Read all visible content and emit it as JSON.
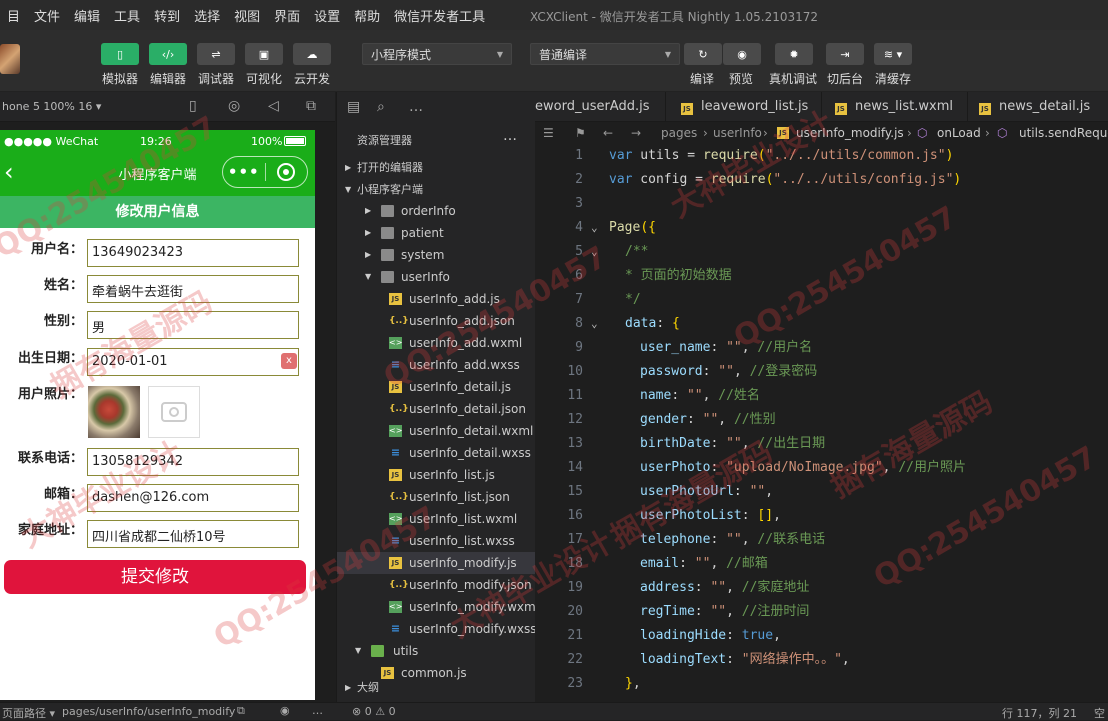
{
  "menubar": {
    "items": [
      "目",
      "文件",
      "编辑",
      "工具",
      "转到",
      "选择",
      "视图",
      "界面",
      "设置",
      "帮助",
      "微信开发者工具"
    ],
    "window_title": "XCXClient - 微信开发者工具 Nightly 1.05.2103172"
  },
  "toolbar": {
    "buttons": [
      {
        "label": "模拟器",
        "icon": "phone-icon"
      },
      {
        "label": "编辑器",
        "icon": "code-icon"
      },
      {
        "label": "调试器",
        "icon": "sliders-icon"
      },
      {
        "label": "可视化",
        "icon": "layout-icon"
      },
      {
        "label": "云开发",
        "icon": "cloud-icon"
      }
    ],
    "mode_select": "小程序模式",
    "compile_select": "普通编译",
    "actions": [
      {
        "label": "编译",
        "icon": "refresh-icon"
      },
      {
        "label": "预览",
        "icon": "eye-icon"
      },
      {
        "label": "真机调试",
        "icon": "bug-icon"
      },
      {
        "label": "切后台",
        "icon": "switch-icon"
      },
      {
        "label": "清缓存",
        "icon": "layers-icon"
      }
    ]
  },
  "simulator": {
    "device_label": "hone 5 100% 16 ▾",
    "statusbar": {
      "carrier": "●●●●● WeChat",
      "time": "19:26",
      "battery": "100%"
    },
    "nav_title": "小程序客户端",
    "form_title": "修改用户信息",
    "fields": [
      {
        "label": "用户名：",
        "value": "13649023423"
      },
      {
        "label": "姓名：",
        "value": "牵着蜗牛去逛街"
      },
      {
        "label": "性别：",
        "value": "男"
      },
      {
        "label": "出生日期：",
        "value": "2020-01-01",
        "clear": "x"
      },
      {
        "label": "用户照片：",
        "value": ""
      },
      {
        "label": "联系电话：",
        "value": "13058129342"
      },
      {
        "label": "邮箱：",
        "value": "dashen@126.com"
      },
      {
        "label": "家庭地址：",
        "value": "四川省成都二仙桥10号"
      }
    ],
    "submit_label": "提交修改"
  },
  "footer": {
    "path_label": "页面路径 ▾",
    "path_value": "pages/userInfo/userInfo_modify",
    "problems": "⊗ 0 ⚠ 0",
    "cursor": "行 117，列 21",
    "right": "空"
  },
  "explorer": {
    "title": "资源管理器",
    "open_editors": "打开的编辑器",
    "project": "小程序客户端",
    "outline": "大纲",
    "tree": [
      {
        "name": "orderInfo",
        "type": "folder"
      },
      {
        "name": "patient",
        "type": "folder"
      },
      {
        "name": "system",
        "type": "folder"
      },
      {
        "name": "userInfo",
        "type": "folder-open"
      },
      {
        "name": "userInfo_add.js",
        "type": "js"
      },
      {
        "name": "userInfo_add.json",
        "type": "json"
      },
      {
        "name": "userInfo_add.wxml",
        "type": "wxml"
      },
      {
        "name": "userInfo_add.wxss",
        "type": "wxss"
      },
      {
        "name": "userInfo_detail.js",
        "type": "js"
      },
      {
        "name": "userInfo_detail.json",
        "type": "json"
      },
      {
        "name": "userInfo_detail.wxml",
        "type": "wxml"
      },
      {
        "name": "userInfo_detail.wxss",
        "type": "wxss"
      },
      {
        "name": "userInfo_list.js",
        "type": "js"
      },
      {
        "name": "userInfo_list.json",
        "type": "json"
      },
      {
        "name": "userInfo_list.wxml",
        "type": "wxml"
      },
      {
        "name": "userInfo_list.wxss",
        "type": "wxss"
      },
      {
        "name": "userInfo_modify.js",
        "type": "js",
        "selected": true
      },
      {
        "name": "userInfo_modify.json",
        "type": "json"
      },
      {
        "name": "userInfo_modify.wxml",
        "type": "wxml"
      },
      {
        "name": "userInfo_modify.wxss",
        "type": "wxss"
      },
      {
        "name": "utils",
        "type": "folder-green"
      },
      {
        "name": "common.js",
        "type": "js"
      }
    ]
  },
  "editor": {
    "tabs": [
      "eword_userAdd.js",
      "leaveword_list.js",
      "news_list.wxml",
      "news_detail.js"
    ],
    "breadcrumb": [
      "pages",
      "userInfo",
      "userInfo_modify.js",
      "onLoad",
      "utils.sendReque"
    ],
    "lines": [
      {
        "n": "1",
        "t": "var utils = require(\"../../utils/common.js\")"
      },
      {
        "n": "2",
        "t": "var config = require(\"../../utils/config.js\")"
      },
      {
        "n": "3",
        "t": ""
      },
      {
        "n": "4",
        "t": "Page({"
      },
      {
        "n": "5",
        "t": "/**"
      },
      {
        "n": "6",
        "t": " * 页面的初始数据"
      },
      {
        "n": "7",
        "t": " */"
      },
      {
        "n": "8",
        "t": "data: {"
      },
      {
        "n": "9",
        "t": "user_name: \"\", //用户名"
      },
      {
        "n": "10",
        "t": "password: \"\", //登录密码"
      },
      {
        "n": "11",
        "t": "name: \"\", //姓名"
      },
      {
        "n": "12",
        "t": "gender: \"\", //性别"
      },
      {
        "n": "13",
        "t": "birthDate: \"\", //出生日期"
      },
      {
        "n": "14",
        "t": "userPhoto: \"upload/NoImage.jpg\", //用户照片"
      },
      {
        "n": "15",
        "t": "userPhotoUrl: \"\","
      },
      {
        "n": "16",
        "t": "userPhotoList: [],"
      },
      {
        "n": "17",
        "t": "telephone: \"\", //联系电话"
      },
      {
        "n": "18",
        "t": "email: \"\", //邮箱"
      },
      {
        "n": "19",
        "t": "address: \"\", //家庭地址"
      },
      {
        "n": "20",
        "t": "regTime: \"\", //注册时间"
      },
      {
        "n": "21",
        "t": "loadingHide: true,"
      },
      {
        "n": "22",
        "t": "loadingText: \"网络操作中。。\","
      },
      {
        "n": "23",
        "t": "},"
      }
    ]
  },
  "watermarks": [
    "QQ:254540457",
    "捆有海量源码",
    "大神毕业设计"
  ],
  "colors": {
    "wechat_green": "#1aad19",
    "submit_red": "#e0143c",
    "form_head": "#3cb563"
  }
}
